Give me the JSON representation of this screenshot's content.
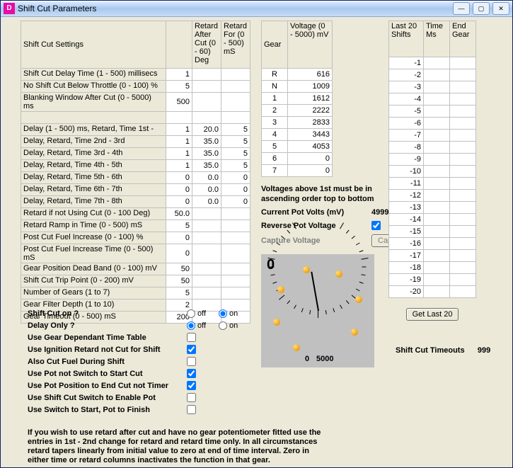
{
  "window": {
    "title": "Shift Cut Parameters"
  },
  "settings_table": {
    "headers": {
      "c0": "Shift Cut Settings",
      "c1": "",
      "c2": "Retard After Cut (0 - 60) Deg",
      "c3": "Retard For (0 - 500) mS"
    },
    "rows": [
      {
        "label": "Shift Cut Delay Time (1 - 500) millisecs",
        "v1": "1",
        "v2": "",
        "v3": ""
      },
      {
        "label": "No Shift Cut Below Throttle (0 - 100) %",
        "v1": "5",
        "v2": "",
        "v3": ""
      },
      {
        "label": "Blanking Window After Cut (0 - 5000) ms",
        "v1": "500",
        "v2": "",
        "v3": ""
      },
      {
        "spacer": true
      },
      {
        "label": "Delay (1 - 500) ms, Retard, Time 1st -",
        "v1": "1",
        "v2": "20.0",
        "v3": "5"
      },
      {
        "label": "Delay, Retard, Time 2nd - 3rd",
        "v1": "1",
        "v2": "35.0",
        "v3": "5"
      },
      {
        "label": "Delay, Retard, Time 3rd - 4th",
        "v1": "1",
        "v2": "35.0",
        "v3": "5"
      },
      {
        "label": "Delay, Retard, Time 4th - 5th",
        "v1": "1",
        "v2": "35.0",
        "v3": "5"
      },
      {
        "label": "Delay, Retard, Time 5th - 6th",
        "v1": "0",
        "v2": "0.0",
        "v3": "0"
      },
      {
        "label": "Delay, Retard, Time 6th - 7th",
        "v1": "0",
        "v2": "0.0",
        "v3": "0"
      },
      {
        "label": "Delay, Retard, Time 7th - 8th",
        "v1": "0",
        "v2": "0.0",
        "v3": "0"
      },
      {
        "label": "Retard if not Using Cut (0 - 100 Deg)",
        "v1": "50.0",
        "v2": "",
        "v3": ""
      },
      {
        "label": "Retard Ramp in Time (0 - 500) mS",
        "v1": "5",
        "v2": "",
        "v3": ""
      },
      {
        "label": "Post Cut Fuel Increase (0 - 100) %",
        "v1": "0",
        "v2": "",
        "v3": ""
      },
      {
        "label": "Post Cut Fuel Increase Time (0 - 500) mS",
        "v1": "0",
        "v2": "",
        "v3": ""
      },
      {
        "label": "Gear Position Dead Band (0 - 100) mV",
        "v1": "50",
        "v2": "",
        "v3": ""
      },
      {
        "label": "Shift Cut Trip Point (0 - 200) mV",
        "v1": "50",
        "v2": "",
        "v3": ""
      },
      {
        "label": "Number of Gears (1 to 7)",
        "v1": "5",
        "v2": "",
        "v3": ""
      },
      {
        "label": "Gear Filter Depth (1 to 10)",
        "v1": "2",
        "v2": "",
        "v3": ""
      },
      {
        "label": "Gear Timeout (0 - 500) mS",
        "v1": "200",
        "v2": "",
        "v3": ""
      }
    ]
  },
  "gear_table": {
    "headers": {
      "c0": "Gear",
      "c1": "Voltage (0 - 5000) mV"
    },
    "rows": [
      {
        "g": "R",
        "v": "616"
      },
      {
        "g": "N",
        "v": "1009"
      },
      {
        "g": "1",
        "v": "1612"
      },
      {
        "g": "2",
        "v": "2222"
      },
      {
        "g": "3",
        "v": "2833"
      },
      {
        "g": "4",
        "v": "3443"
      },
      {
        "g": "5",
        "v": "4053"
      },
      {
        "g": "6",
        "v": "0"
      },
      {
        "g": "7",
        "v": "0"
      }
    ]
  },
  "shifts_table": {
    "headers": {
      "c0": "Last 20 Shifts",
      "c1": "Time Ms",
      "c2": "End Gear"
    },
    "rows": [
      {
        "a": "-1",
        "b": "",
        "c": ""
      },
      {
        "a": "-2",
        "b": "",
        "c": ""
      },
      {
        "a": "-3",
        "b": "",
        "c": ""
      },
      {
        "a": "-4",
        "b": "",
        "c": ""
      },
      {
        "a": "-5",
        "b": "",
        "c": ""
      },
      {
        "a": "-6",
        "b": "",
        "c": ""
      },
      {
        "a": "-7",
        "b": "",
        "c": ""
      },
      {
        "a": "-8",
        "b": "",
        "c": ""
      },
      {
        "a": "-9",
        "b": "",
        "c": ""
      },
      {
        "a": "-10",
        "b": "",
        "c": ""
      },
      {
        "a": "-11",
        "b": "",
        "c": ""
      },
      {
        "a": "-12",
        "b": "",
        "c": ""
      },
      {
        "a": "-13",
        "b": "",
        "c": ""
      },
      {
        "a": "-14",
        "b": "",
        "c": ""
      },
      {
        "a": "-15",
        "b": "",
        "c": ""
      },
      {
        "a": "-16",
        "b": "",
        "c": ""
      },
      {
        "a": "-17",
        "b": "",
        "c": ""
      },
      {
        "a": "-18",
        "b": "",
        "c": ""
      },
      {
        "a": "-19",
        "b": "",
        "c": ""
      },
      {
        "a": "-20",
        "b": "",
        "c": ""
      }
    ]
  },
  "options": {
    "shift_cut_on": {
      "label": "Shift Cut on ?",
      "value": "on"
    },
    "delay_only": {
      "label": "Delay Only ?",
      "value": "off"
    },
    "off": "off",
    "on": "on",
    "checks": [
      {
        "label": "Use Gear Dependant Time Table",
        "checked": false
      },
      {
        "label": "Use Ignition Retard not Cut for Shift",
        "checked": true
      },
      {
        "label": "Also Cut Fuel During Shift",
        "checked": false
      },
      {
        "label": "Use Pot not Switch to Start Cut",
        "checked": true
      },
      {
        "label": "Use Pot Position to End Cut not Timer",
        "checked": true
      },
      {
        "label": "Use Shift Cut Switch to Enable Pot",
        "checked": false
      },
      {
        "label": "Use Switch to Start, Pot to Finish",
        "checked": false
      }
    ]
  },
  "gear_section": {
    "note": "Voltages above 1st must be in ascending order top to bottom",
    "pot_label": "Current Pot Volts (mV)",
    "pot_value": "4999",
    "reverse_label": "Reverse Pot Voltage",
    "reverse_checked": true,
    "capture_label": "Capture Voltage",
    "capture_btn": "Capture"
  },
  "gauge": {
    "value": "0",
    "min": "0",
    "max": "5000"
  },
  "buttons": {
    "get_last": "Get Last 20"
  },
  "timeouts": {
    "label": "Shift Cut Timeouts",
    "value": "999"
  },
  "footer_note": "If you wish to use retard after cut and have no gear potentiometer fitted use the entries in 1st - 2nd change for retard and retard time only. In all circumstances retard tapers linearly from initial value to zero at end of time interval. Zero in either time or retard columns inactivates the function in that gear."
}
